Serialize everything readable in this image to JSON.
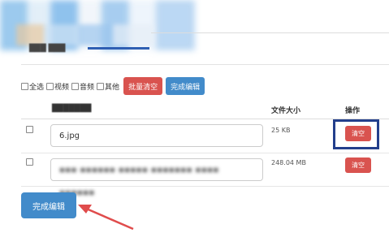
{
  "filters": {
    "all_label": "全选",
    "video_label": "视频",
    "audio_label": "音频",
    "other_label": "其他"
  },
  "toolbar": {
    "batch_clear_label": "批量清空",
    "done_edit_label": "完成编辑"
  },
  "table": {
    "col_size_label": "文件大小",
    "col_op_label": "操作",
    "rows": [
      {
        "name": "6.jpg",
        "size": "25 KB",
        "action": "清空"
      },
      {
        "size": "248.04 MB",
        "action": "清空"
      }
    ]
  },
  "footer": {
    "finish_label": "完成编辑"
  },
  "colors": {
    "danger": "#d9534f",
    "primary": "#428bca",
    "highlight_border": "#233f8c",
    "annotation_arrow": "#e04c4c"
  }
}
